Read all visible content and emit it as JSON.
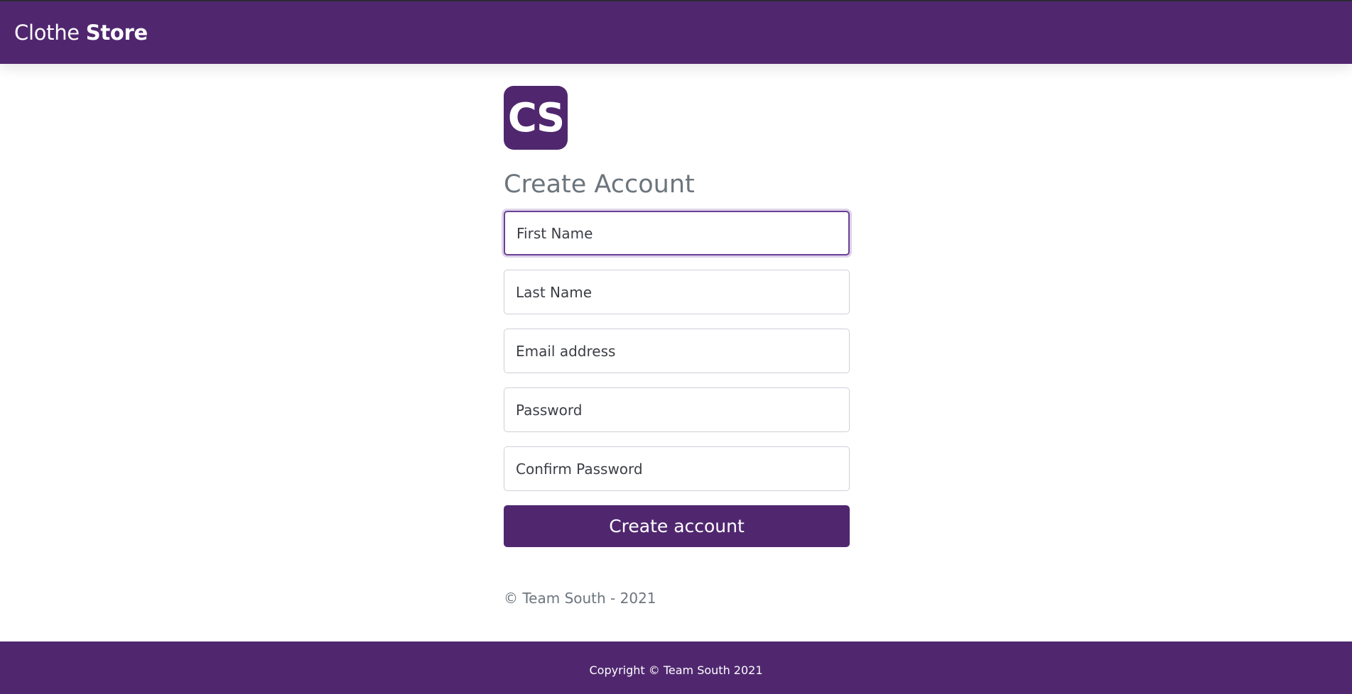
{
  "navbar": {
    "brand_light": "Clothe",
    "brand_bold": "Store"
  },
  "logo": {
    "text": "CS"
  },
  "form": {
    "title": "Create Account",
    "first_name_placeholder": "First Name",
    "last_name_placeholder": "Last Name",
    "email_placeholder": "Email address",
    "password_placeholder": "Password",
    "confirm_password_placeholder": "Confirm Password",
    "submit_label": "Create account"
  },
  "copyright": "© Team South - 2021",
  "footer": {
    "text": "Copyright © Team South 2021"
  },
  "colors": {
    "brand": "#50276f",
    "muted_text": "#6c757d"
  }
}
